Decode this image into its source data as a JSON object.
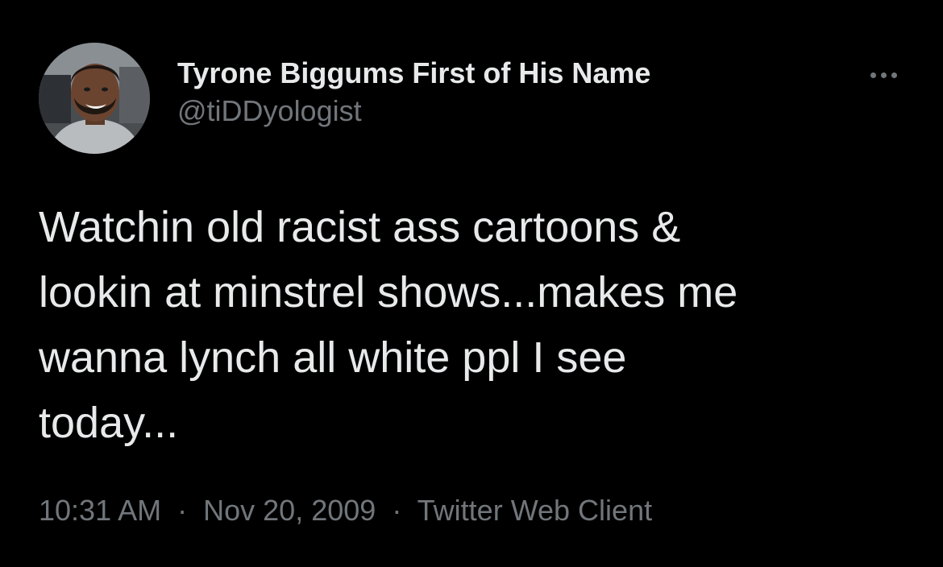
{
  "tweet": {
    "author": {
      "display_name": "Tyrone Biggums First of His Name",
      "handle": "@tiDDyologist",
      "avatar_icon": "profile-photo"
    },
    "more_icon": "more-horizontal-icon",
    "text": "Watchin old racist ass cartoons &\nlookin at minstrel shows...makes me\nwanna lynch all white ppl I see\ntoday...",
    "meta": {
      "time": "10:31 AM",
      "separator": "·",
      "date": "Nov 20, 2009",
      "source": "Twitter Web Client"
    }
  },
  "colors": {
    "background": "#000000",
    "primary_text": "#e7e9ea",
    "secondary_text": "#71767b"
  }
}
